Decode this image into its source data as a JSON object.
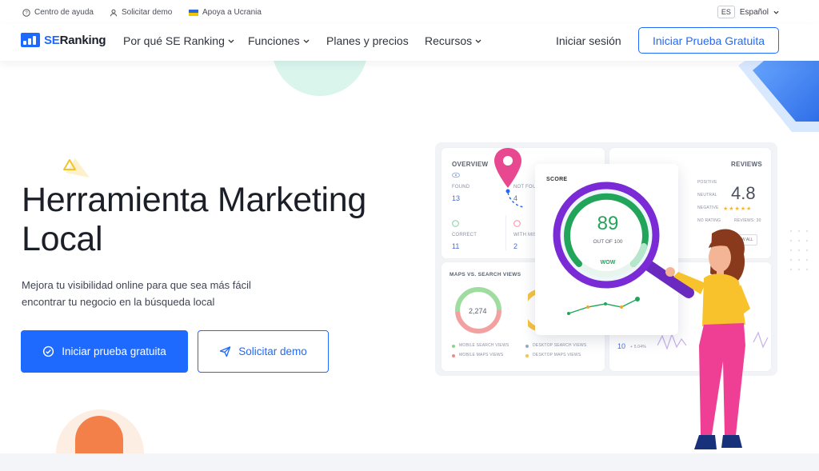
{
  "topbar": {
    "help": "Centro de ayuda",
    "demo": "Solicitar demo",
    "ukraine": "Apoya a Ucrania",
    "lang_code": "ES",
    "lang_name": "Español"
  },
  "nav": {
    "logo_se": "SE",
    "logo_ranking": "Ranking",
    "items": [
      {
        "label": "Por qué SE Ranking"
      },
      {
        "label": "Funciones"
      },
      {
        "label": "Planes y precios"
      },
      {
        "label": "Recursos"
      }
    ],
    "login": "Iniciar sesión",
    "cta": "Iniciar Prueba Gratuita"
  },
  "hero": {
    "title": "Herramienta Marketing Local",
    "subtitle": "Mejora tu visibilidad online para que sea más fácil encontrar tu negocio en la búsqueda local",
    "primary_button": "Iniciar prueba gratuita",
    "secondary_button": "Solicitar demo"
  },
  "dashboard": {
    "overview": {
      "title": "OVERVIEW",
      "found_label": "FOUND",
      "found_value": "13",
      "not_found_label": "NOT FOU",
      "not_found_value": "4",
      "correct_label": "CORRECT",
      "correct_value": "11",
      "with_mis_label": "WITH MIS",
      "with_mis_value": "2"
    },
    "score": {
      "title": "SCORE",
      "value": "89",
      "out_of": "OUT OF 100",
      "rating": "WOW"
    },
    "reviews": {
      "title": "REVIEWS",
      "positive": "POSITIVE",
      "neutral": "NEUTRAL",
      "negative": "NEGATIVE",
      "no_rating": "NO RATING",
      "value": "4.8",
      "count": "REVIEWS: 30",
      "view_all": "VIEW ALL"
    },
    "maps": {
      "title": "MAPS VS. SEARCH VIEWS",
      "total": "2,274",
      "legend": [
        "MOBILE SEARCH VIEWS",
        "DESKTOP SEARCH VIEWS",
        "MOBILE MAPS VIEWS",
        "DESKTOP MAPS VIEWS"
      ]
    },
    "calls": {
      "value": "10",
      "change": "+ 5.04%"
    }
  },
  "colors": {
    "brand": "#1e6aff",
    "score_green": "#22a55a",
    "score_purple": "#7a2bd6",
    "pin": "#e8488f"
  }
}
